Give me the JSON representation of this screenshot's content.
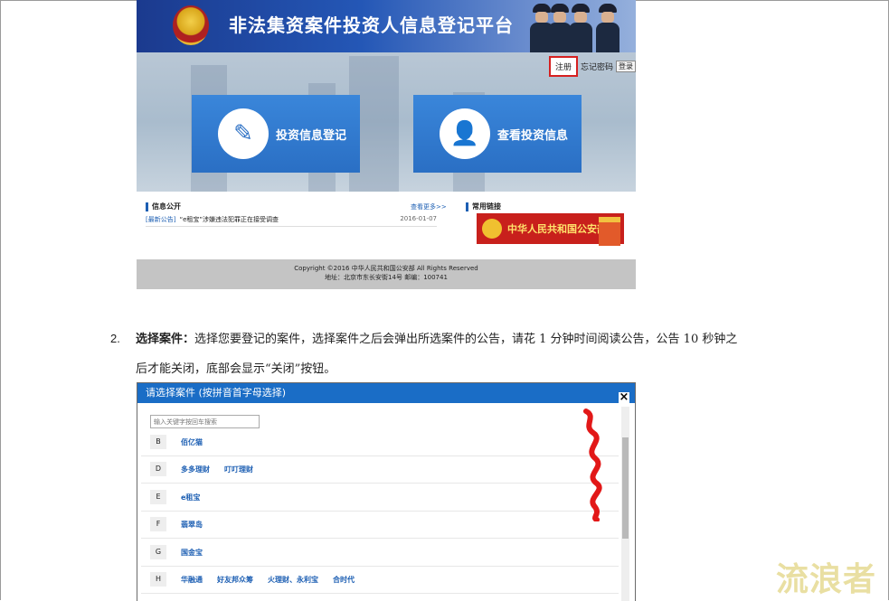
{
  "shot1": {
    "site_title": "非法集资案件投资人信息登记平台",
    "register": "注册",
    "forgot_password": "忘记密码",
    "login": "登录",
    "btn_register_info": "投资信息登记",
    "btn_view_info": "查看投资信息",
    "info_public": "信息公开",
    "view_more": "查看更多>>",
    "news_tag": "[最新公告]",
    "news_text": "“e租宝”涉嫌违法犯罪正在接受调查",
    "news_date": "2016-01-07",
    "common_links": "常用链接",
    "mps_banner": "中华人民共和国公安部",
    "footer_line1": "Copyright ©2016 中华人民共和国公安部  All Rights Reserved",
    "footer_line2": "地址：北京市东长安街14号 邮编：100741"
  },
  "para": {
    "number": "2.",
    "bold_label": "选择案件：",
    "line1": "选择您要登记的案件，选择案件之后会弹出所选案件的公告，请花 1 分钟时间阅读公告，公告 10 秒钟之",
    "line2": "后才能关闭，底部会显示“关闭”按钮。"
  },
  "dialog": {
    "title": "请选择案件 (按拼音首字母选择)",
    "close": "×",
    "search_placeholder": "输入关键字按回车搜索",
    "rows": [
      {
        "letter": "B",
        "items": [
          "佰亿猫"
        ]
      },
      {
        "letter": "D",
        "items": [
          "多多理财",
          "叮叮理财"
        ]
      },
      {
        "letter": "E",
        "items": [
          "e租宝"
        ]
      },
      {
        "letter": "F",
        "items": [
          "翡翠岛"
        ]
      },
      {
        "letter": "G",
        "items": [
          "国金宝"
        ]
      },
      {
        "letter": "H",
        "items": [
          "华融通",
          "好友邦众筹",
          "火理财、永利宝",
          "合时代"
        ]
      }
    ]
  },
  "watermark": "流浪者",
  "colors": {
    "accent_blue": "#1a6dc6",
    "highlight_red": "#d62020"
  }
}
